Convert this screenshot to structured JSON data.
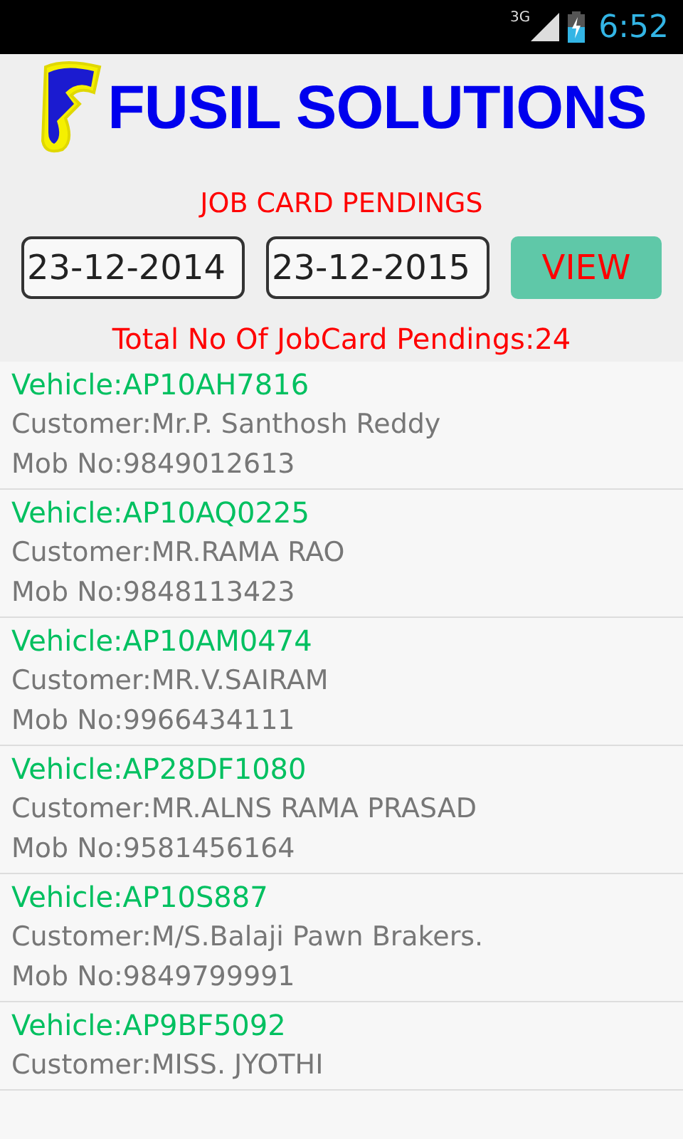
{
  "status_bar": {
    "network": "3G",
    "time": "6:52"
  },
  "header": {
    "title": "FUSIL SOLUTIONS"
  },
  "heading": "JOB CARD PENDINGS",
  "filters": {
    "from_date": "23-12-2014",
    "to_date": "23-12-2015",
    "button": "VIEW"
  },
  "total": "Total No Of JobCard Pendings:24",
  "jobs": [
    {
      "vehicle": "Vehicle:AP10AH7816",
      "customer": "Customer:Mr.P. Santhosh Reddy",
      "mobile": "Mob No:9849012613"
    },
    {
      "vehicle": "Vehicle:AP10AQ0225",
      "customer": "Customer:MR.RAMA RAO",
      "mobile": "Mob No:9848113423"
    },
    {
      "vehicle": "Vehicle:AP10AM0474",
      "customer": "Customer:MR.V.SAIRAM",
      "mobile": "Mob No:9966434111"
    },
    {
      "vehicle": "Vehicle:AP28DF1080",
      "customer": "Customer:MR.ALNS RAMA PRASAD",
      "mobile": "Mob No:9581456164"
    },
    {
      "vehicle": "Vehicle:AP10S887",
      "customer": "Customer:M/S.Balaji Pawn Brakers.",
      "mobile": "Mob No:9849799991"
    },
    {
      "vehicle": "Vehicle:AP9BF5092",
      "customer": "Customer:MISS. JYOTHI"
    }
  ]
}
